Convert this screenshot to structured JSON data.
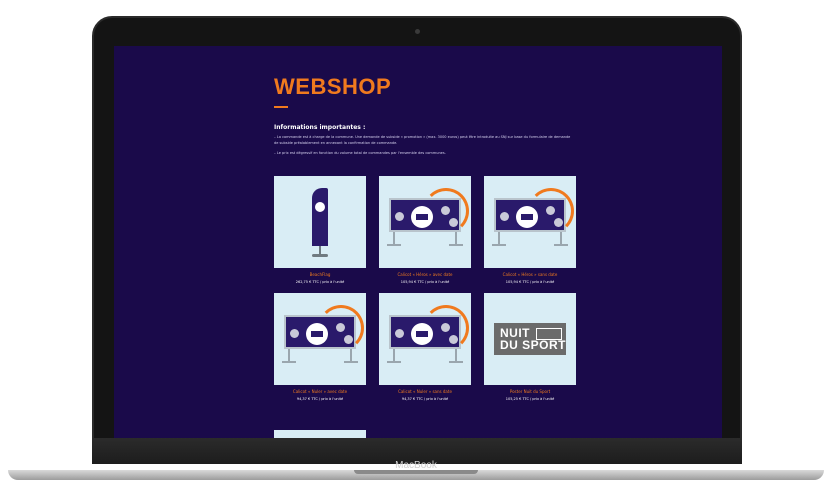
{
  "device": {
    "brand_label": "MacBook"
  },
  "page": {
    "title": "WEBSHOP",
    "info_heading": "Informations importantes :",
    "info_lines": [
      "– La commande est à charge de la commune. Une demande de subside « promotion » (max. 3000 euros) peut être introduite au SNJ sur base du formulaire de demande de subside préalablement en annexant la confirmation de commande.",
      "– Le prix est dégressif en fonction du volume total de commandes par l'ensemble des communes."
    ]
  },
  "products": [
    {
      "name": "BeachFlag",
      "price": "262,75 € TTC / prix à l'unité",
      "art": "flag"
    },
    {
      "name": "Calicot « Héros » avec date",
      "price": "105,94 € TTC / prix à l'unité",
      "art": "banner"
    },
    {
      "name": "Calicot « Héros » sans date",
      "price": "105,94 € TTC / prix à l'unité",
      "art": "banner"
    },
    {
      "name": "Calicot « Nuler » avec date",
      "price": "94,37 € TTC / prix à l'unité",
      "art": "banner"
    },
    {
      "name": "Calicot « Nuler » sans date",
      "price": "94,37 € TTC / prix à l'unité",
      "art": "banner"
    },
    {
      "name": "Poster Nuit du Sport",
      "price": "105,25 € TTC / prix à l'unité",
      "art": "poster"
    }
  ],
  "poster_text": {
    "line1": "NUIT",
    "line2": "DU SPORT"
  },
  "colors": {
    "accent": "#f07a1e",
    "background": "#1a0a4a",
    "thumb_bg": "#d9edf5"
  }
}
